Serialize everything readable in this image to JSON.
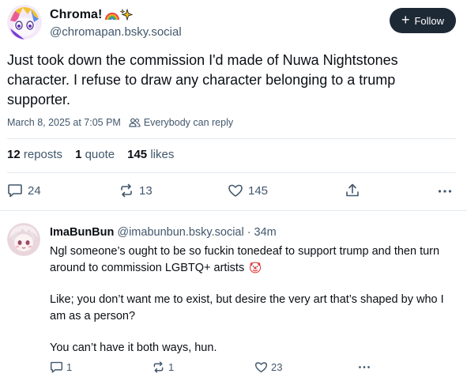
{
  "post": {
    "display_name": "Chroma!",
    "name_emojis": [
      "rainbow-icon",
      "sparkles-icon"
    ],
    "handle": "@chromapan.bsky.social",
    "follow_label": "Follow",
    "text": "Just took down the commission I'd made of Nuwa Nightstones character. I refuse to draw any character belonging to a trump supporter.",
    "timestamp": "March 8, 2025 at 7:05 PM",
    "reply_permission": "Everybody can reply",
    "stats": {
      "reposts_count": "12",
      "reposts_label": "reposts",
      "quotes_count": "1",
      "quotes_label": "quote",
      "likes_count": "145",
      "likes_label": "likes"
    },
    "actions": {
      "replies": "24",
      "reposts": "13",
      "likes": "145"
    }
  },
  "reply": {
    "display_name": "ImaBunBun",
    "handle": "@imabunbun.bsky.social",
    "separator": "·",
    "time": "34m",
    "paragraphs": [
      "Ngl someone’s ought to be so fuckin tonedeaf to support trump and then turn around to commission LGBTQ+ artists",
      "Like; you don’t want me to exist, but desire the very art that’s shaped by who I am as a person?",
      "You can’t have it both ways, hun."
    ],
    "actions": {
      "replies": "1",
      "reposts": "1",
      "likes": "23"
    }
  },
  "colors": {
    "text_primary": "#0b0f14",
    "text_secondary": "#42576c",
    "follow_bg": "#1e2936",
    "divider": "#e4e9ef"
  }
}
